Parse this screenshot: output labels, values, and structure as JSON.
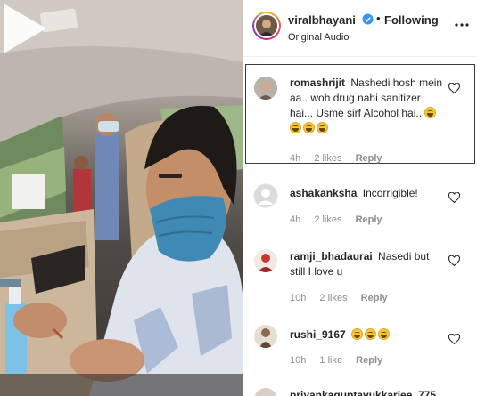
{
  "post": {
    "username": "viralbhayani",
    "separator": "•",
    "follow_status": "Following",
    "audio": "Original Audio"
  },
  "comments": [
    {
      "username": "romashrijit",
      "text": "Nashedi hosh mein aa.. woh drug nahi sanitizer hai... Usme sirf Alcohol hai..",
      "emoji_count": 4,
      "time": "4h",
      "likes": "2 likes",
      "reply": "Reply",
      "avatar_color": "#b9b2a8"
    },
    {
      "username": "ashakanksha",
      "text": "Incorrigible!",
      "emoji_count": 0,
      "time": "4h",
      "likes": "2 likes",
      "reply": "Reply",
      "avatar_color": "#dbdbdb"
    },
    {
      "username": "ramji_bhadaurai",
      "text": "Nasedi but still I love u",
      "emoji_count": 0,
      "time": "10h",
      "likes": "2 likes",
      "reply": "Reply",
      "avatar_color": "#c6352e"
    },
    {
      "username": "rushi_9167",
      "text": "",
      "emoji_count": 3,
      "time": "10h",
      "likes": "1 like",
      "reply": "Reply",
      "avatar_color": "#8a6c4f"
    },
    {
      "username": "priyankaguptayukkarjee_775",
      "text": "",
      "emoji_count": 0,
      "time": "",
      "likes": "",
      "reply": "",
      "avatar_color": "#d9cfc6"
    }
  ],
  "icons": {
    "verified": "verified-badge-icon",
    "more": "more-options-icon",
    "like": "heart-icon",
    "play": "play-icon"
  },
  "colors": {
    "verified_blue": "#3897f0",
    "meta_gray": "#8e8e8e",
    "text": "#262626"
  }
}
